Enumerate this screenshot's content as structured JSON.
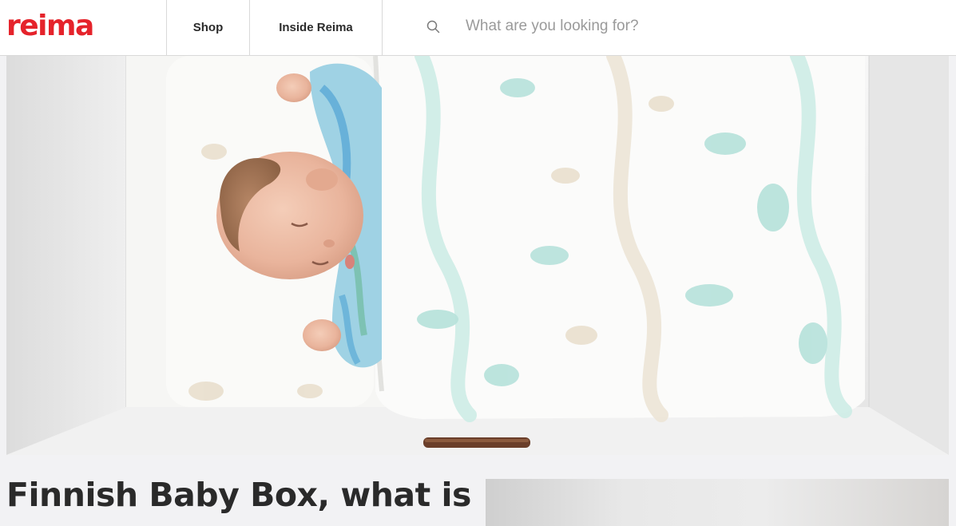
{
  "header": {
    "logo_text": "reima",
    "nav": [
      {
        "label": "Shop"
      },
      {
        "label": "Inside Reima"
      }
    ],
    "search": {
      "icon": "search-icon",
      "placeholder": "What are you looking for?"
    }
  },
  "hero": {
    "image": "sleeping-baby-in-box-image"
  },
  "article": {
    "title": "Finnish Baby Box, what is"
  },
  "colors": {
    "brand_red": "#e5232b",
    "header_bg": "#ffffff",
    "page_bg": "#f2f2f4"
  }
}
